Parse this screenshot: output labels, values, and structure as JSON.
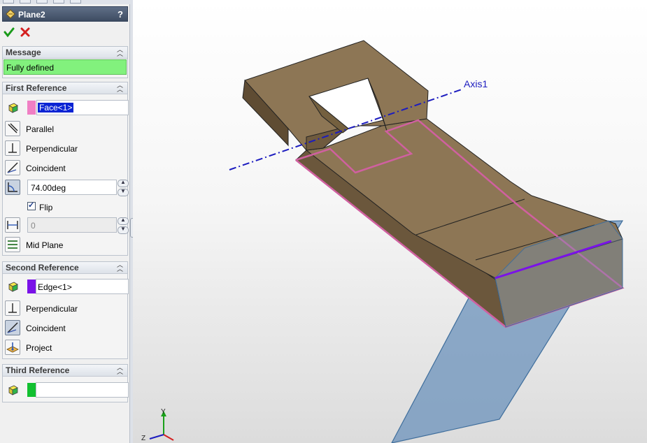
{
  "property_manager": {
    "title": "Plane2",
    "help_label": "?",
    "ok_icon": "green-checkmark-icon",
    "cancel_icon": "red-x-icon",
    "message": {
      "header": "Message",
      "text": "Fully defined",
      "color": "#82f17d"
    },
    "first_reference": {
      "header": "First Reference",
      "selection": "Face<1>",
      "swatch_color": "#f07fc4",
      "options": {
        "parallel": "Parallel",
        "perpendicular": "Perpendicular",
        "coincident": "Coincident"
      },
      "angle_value": "74.00deg",
      "flip_label": "Flip",
      "flip_checked": true,
      "distance_value": "0",
      "mid_plane": "Mid Plane"
    },
    "second_reference": {
      "header": "Second Reference",
      "selection": "Edge<1>",
      "swatch_color": "#7a12e8",
      "options": {
        "perpendicular": "Perpendicular",
        "coincident": "Coincident",
        "project": "Project"
      }
    },
    "third_reference": {
      "header": "Third Reference",
      "selection": "",
      "swatch_color": "#12c030"
    }
  },
  "viewport": {
    "axis_label": "Axis1",
    "triad": {
      "y_label": "Y",
      "z_label": "Z"
    },
    "colors": {
      "part": "#8b7453",
      "edge_highlight": "#d060a0",
      "plane": "#6f95bd",
      "axis": "#1c1cbf",
      "selected_edge": "#7a12e8"
    }
  }
}
